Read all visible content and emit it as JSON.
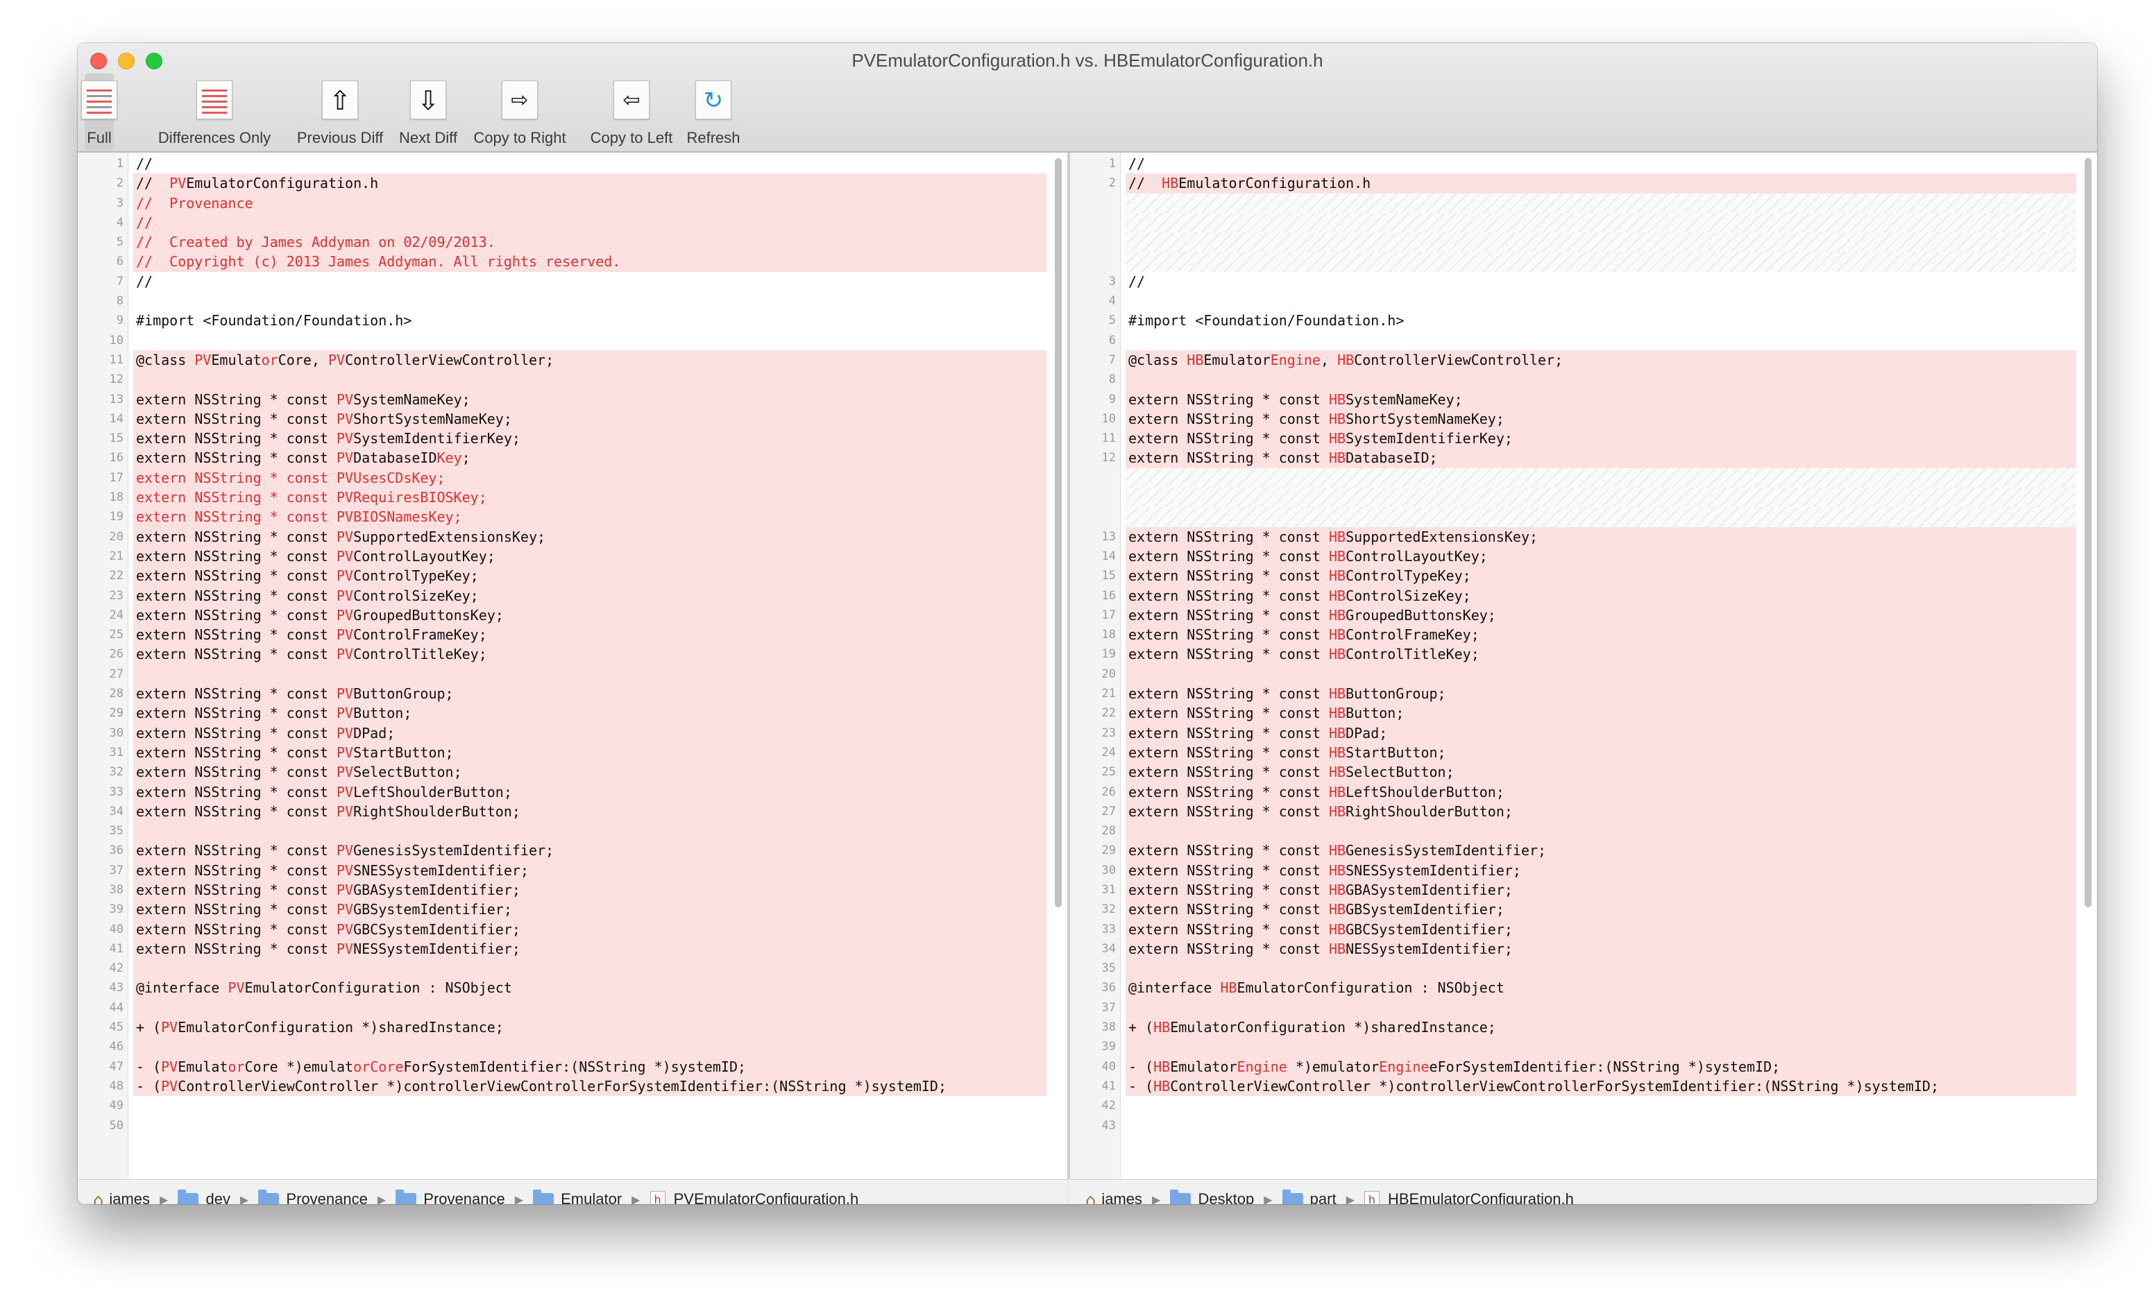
{
  "window": {
    "title": "PVEmulatorConfiguration.h vs. HBEmulatorConfiguration.h"
  },
  "toolbar": {
    "full": "Full",
    "differences_only": "Differences Only",
    "previous_diff": "Previous Diff",
    "next_diff": "Next Diff",
    "copy_to_right": "Copy to Right",
    "copy_to_left": "Copy to Left",
    "refresh": "Refresh"
  },
  "left": {
    "lines": [
      {
        "n": "1",
        "t": "//",
        "s": "n"
      },
      {
        "n": "2",
        "p": [
          "//  ",
          {
            "r": "PV"
          },
          "EmulatorConfiguration.h"
        ],
        "s": "d"
      },
      {
        "n": "3",
        "t": "//  Provenance",
        "s": "dr"
      },
      {
        "n": "4",
        "t": "//",
        "s": "dr"
      },
      {
        "n": "5",
        "t": "//  Created by James Addyman on 02/09/2013.",
        "s": "dr"
      },
      {
        "n": "6",
        "t": "//  Copyright (c) 2013 James Addyman. All rights reserved.",
        "s": "dr"
      },
      {
        "n": "7",
        "t": "//",
        "s": "n"
      },
      {
        "n": "8",
        "t": "",
        "s": "n"
      },
      {
        "n": "9",
        "t": "#import <Foundation/Foundation.h>",
        "s": "n"
      },
      {
        "n": "10",
        "t": "",
        "s": "n"
      },
      {
        "n": "11",
        "p": [
          "@class ",
          {
            "r": "PV"
          },
          "Emulat",
          {
            "r": "or"
          },
          "Core, ",
          {
            "r": "PV"
          },
          "ControllerViewController;"
        ],
        "s": "d"
      },
      {
        "n": "12",
        "t": "",
        "s": "d"
      },
      {
        "n": "13",
        "p": [
          "extern NSString * const ",
          {
            "r": "PV"
          },
          "SystemNameKey;"
        ],
        "s": "d"
      },
      {
        "n": "14",
        "p": [
          "extern NSString * const ",
          {
            "r": "PV"
          },
          "ShortSystemNameKey;"
        ],
        "s": "d"
      },
      {
        "n": "15",
        "p": [
          "extern NSString * const ",
          {
            "r": "PV"
          },
          "SystemIdentifierKey;"
        ],
        "s": "d"
      },
      {
        "n": "16",
        "p": [
          "extern NSString * const ",
          {
            "r": "PV"
          },
          "DatabaseID",
          {
            "r": "Key"
          },
          ";"
        ],
        "s": "d"
      },
      {
        "n": "17",
        "t": "extern NSString * const PVUsesCDsKey;",
        "s": "dr"
      },
      {
        "n": "18",
        "t": "extern NSString * const PVRequiresBIOSKey;",
        "s": "dr"
      },
      {
        "n": "19",
        "t": "extern NSString * const PVBIOSNamesKey;",
        "s": "dr"
      },
      {
        "n": "20",
        "p": [
          "extern NSString * const ",
          {
            "r": "PV"
          },
          "SupportedExtensionsKey;"
        ],
        "s": "d"
      },
      {
        "n": "21",
        "p": [
          "extern NSString * const ",
          {
            "r": "PV"
          },
          "ControlLayoutKey;"
        ],
        "s": "d"
      },
      {
        "n": "22",
        "p": [
          "extern NSString * const ",
          {
            "r": "PV"
          },
          "ControlTypeKey;"
        ],
        "s": "d"
      },
      {
        "n": "23",
        "p": [
          "extern NSString * const ",
          {
            "r": "PV"
          },
          "ControlSizeKey;"
        ],
        "s": "d"
      },
      {
        "n": "24",
        "p": [
          "extern NSString * const ",
          {
            "r": "PV"
          },
          "GroupedButtonsKey;"
        ],
        "s": "d"
      },
      {
        "n": "25",
        "p": [
          "extern NSString * const ",
          {
            "r": "PV"
          },
          "ControlFrameKey;"
        ],
        "s": "d"
      },
      {
        "n": "26",
        "p": [
          "extern NSString * const ",
          {
            "r": "PV"
          },
          "ControlTitleKey;"
        ],
        "s": "d"
      },
      {
        "n": "27",
        "t": "",
        "s": "d"
      },
      {
        "n": "28",
        "p": [
          "extern NSString * const ",
          {
            "r": "PV"
          },
          "ButtonGroup;"
        ],
        "s": "d"
      },
      {
        "n": "29",
        "p": [
          "extern NSString * const ",
          {
            "r": "PV"
          },
          "Button;"
        ],
        "s": "d"
      },
      {
        "n": "30",
        "p": [
          "extern NSString * const ",
          {
            "r": "PV"
          },
          "DPad;"
        ],
        "s": "d"
      },
      {
        "n": "31",
        "p": [
          "extern NSString * const ",
          {
            "r": "PV"
          },
          "StartButton;"
        ],
        "s": "d"
      },
      {
        "n": "32",
        "p": [
          "extern NSString * const ",
          {
            "r": "PV"
          },
          "SelectButton;"
        ],
        "s": "d"
      },
      {
        "n": "33",
        "p": [
          "extern NSString * const ",
          {
            "r": "PV"
          },
          "LeftShoulderButton;"
        ],
        "s": "d"
      },
      {
        "n": "34",
        "p": [
          "extern NSString * const ",
          {
            "r": "PV"
          },
          "RightShoulderButton;"
        ],
        "s": "d"
      },
      {
        "n": "35",
        "t": "",
        "s": "d"
      },
      {
        "n": "36",
        "p": [
          "extern NSString * const ",
          {
            "r": "PV"
          },
          "GenesisSystemIdentifier;"
        ],
        "s": "d"
      },
      {
        "n": "37",
        "p": [
          "extern NSString * const ",
          {
            "r": "PV"
          },
          "SNESSystemIdentifier;"
        ],
        "s": "d"
      },
      {
        "n": "38",
        "p": [
          "extern NSString * const ",
          {
            "r": "PV"
          },
          "GBASystemIdentifier;"
        ],
        "s": "d"
      },
      {
        "n": "39",
        "p": [
          "extern NSString * const ",
          {
            "r": "PV"
          },
          "GBSystemIdentifier;"
        ],
        "s": "d"
      },
      {
        "n": "40",
        "p": [
          "extern NSString * const ",
          {
            "r": "PV"
          },
          "GBCSystemIdentifier;"
        ],
        "s": "d"
      },
      {
        "n": "41",
        "p": [
          "extern NSString * const ",
          {
            "r": "PV"
          },
          "NESSystemIdentifier;"
        ],
        "s": "d"
      },
      {
        "n": "42",
        "t": "",
        "s": "d"
      },
      {
        "n": "43",
        "p": [
          "@interface ",
          {
            "r": "PV"
          },
          "EmulatorConfiguration : NSObject"
        ],
        "s": "d"
      },
      {
        "n": "44",
        "t": "",
        "s": "d"
      },
      {
        "n": "45",
        "p": [
          "+ (",
          {
            "r": "PV"
          },
          "EmulatorConfiguration *)sharedInstance;"
        ],
        "s": "d"
      },
      {
        "n": "46",
        "t": "",
        "s": "d"
      },
      {
        "n": "47",
        "p": [
          "- (",
          {
            "r": "PV"
          },
          "Emulat",
          {
            "r": "or"
          },
          "Core *)emulat",
          {
            "r": "orCore"
          },
          "ForSystemIdentifier:(NSString *)systemID;"
        ],
        "s": "d"
      },
      {
        "n": "48",
        "p": [
          "- (",
          {
            "r": "PV"
          },
          "ControllerViewController *)controllerViewControllerForSystemIdentifier:(NSString *)systemID;"
        ],
        "s": "d"
      },
      {
        "n": "49",
        "t": "",
        "s": "n"
      },
      {
        "n": "50",
        "t": "",
        "s": "n"
      }
    ]
  },
  "right": {
    "lines": [
      {
        "n": "1",
        "t": "//",
        "s": "n"
      },
      {
        "n": "2",
        "p": [
          "//  ",
          {
            "r": "HB"
          },
          "EmulatorConfiguration.h"
        ],
        "s": "d"
      },
      {
        "n": "",
        "t": "",
        "s": "gap"
      },
      {
        "n": "",
        "t": "",
        "s": "gap"
      },
      {
        "n": "",
        "t": "",
        "s": "gap"
      },
      {
        "n": "",
        "t": "",
        "s": "gap"
      },
      {
        "n": "3",
        "t": "//",
        "s": "n"
      },
      {
        "n": "4",
        "t": "",
        "s": "n"
      },
      {
        "n": "5",
        "t": "#import <Foundation/Foundation.h>",
        "s": "n"
      },
      {
        "n": "6",
        "t": "",
        "s": "n"
      },
      {
        "n": "7",
        "p": [
          "@class ",
          {
            "r": "HB"
          },
          "Emulator",
          {
            "r": "Engine"
          },
          ", ",
          {
            "r": "HB"
          },
          "ControllerViewController;"
        ],
        "s": "d"
      },
      {
        "n": "8",
        "t": "",
        "s": "d"
      },
      {
        "n": "9",
        "p": [
          "extern NSString * const ",
          {
            "r": "HB"
          },
          "SystemNameKey;"
        ],
        "s": "d"
      },
      {
        "n": "10",
        "p": [
          "extern NSString * const ",
          {
            "r": "HB"
          },
          "ShortSystemNameKey;"
        ],
        "s": "d"
      },
      {
        "n": "11",
        "p": [
          "extern NSString * const ",
          {
            "r": "HB"
          },
          "SystemIdentifierKey;"
        ],
        "s": "d"
      },
      {
        "n": "12",
        "p": [
          "extern NSString * const ",
          {
            "r": "HB"
          },
          "DatabaseID;"
        ],
        "s": "d"
      },
      {
        "n": "",
        "t": "",
        "s": "gap"
      },
      {
        "n": "",
        "t": "",
        "s": "gap"
      },
      {
        "n": "",
        "t": "",
        "s": "gap"
      },
      {
        "n": "13",
        "p": [
          "extern NSString * const ",
          {
            "r": "HB"
          },
          "SupportedExtensionsKey;"
        ],
        "s": "d"
      },
      {
        "n": "14",
        "p": [
          "extern NSString * const ",
          {
            "r": "HB"
          },
          "ControlLayoutKey;"
        ],
        "s": "d"
      },
      {
        "n": "15",
        "p": [
          "extern NSString * const ",
          {
            "r": "HB"
          },
          "ControlTypeKey;"
        ],
        "s": "d"
      },
      {
        "n": "16",
        "p": [
          "extern NSString * const ",
          {
            "r": "HB"
          },
          "ControlSizeKey;"
        ],
        "s": "d"
      },
      {
        "n": "17",
        "p": [
          "extern NSString * const ",
          {
            "r": "HB"
          },
          "GroupedButtonsKey;"
        ],
        "s": "d"
      },
      {
        "n": "18",
        "p": [
          "extern NSString * const ",
          {
            "r": "HB"
          },
          "ControlFrameKey;"
        ],
        "s": "d"
      },
      {
        "n": "19",
        "p": [
          "extern NSString * const ",
          {
            "r": "HB"
          },
          "ControlTitleKey;"
        ],
        "s": "d"
      },
      {
        "n": "20",
        "t": "",
        "s": "d"
      },
      {
        "n": "21",
        "p": [
          "extern NSString * const ",
          {
            "r": "HB"
          },
          "ButtonGroup;"
        ],
        "s": "d"
      },
      {
        "n": "22",
        "p": [
          "extern NSString * const ",
          {
            "r": "HB"
          },
          "Button;"
        ],
        "s": "d"
      },
      {
        "n": "23",
        "p": [
          "extern NSString * const ",
          {
            "r": "HB"
          },
          "DPad;"
        ],
        "s": "d"
      },
      {
        "n": "24",
        "p": [
          "extern NSString * const ",
          {
            "r": "HB"
          },
          "StartButton;"
        ],
        "s": "d"
      },
      {
        "n": "25",
        "p": [
          "extern NSString * const ",
          {
            "r": "HB"
          },
          "SelectButton;"
        ],
        "s": "d"
      },
      {
        "n": "26",
        "p": [
          "extern NSString * const ",
          {
            "r": "HB"
          },
          "LeftShoulderButton;"
        ],
        "s": "d"
      },
      {
        "n": "27",
        "p": [
          "extern NSString * const ",
          {
            "r": "HB"
          },
          "RightShoulderButton;"
        ],
        "s": "d"
      },
      {
        "n": "28",
        "t": "",
        "s": "d"
      },
      {
        "n": "29",
        "p": [
          "extern NSString * const ",
          {
            "r": "HB"
          },
          "GenesisSystemIdentifier;"
        ],
        "s": "d"
      },
      {
        "n": "30",
        "p": [
          "extern NSString * const ",
          {
            "r": "HB"
          },
          "SNESSystemIdentifier;"
        ],
        "s": "d"
      },
      {
        "n": "31",
        "p": [
          "extern NSString * const ",
          {
            "r": "HB"
          },
          "GBASystemIdentifier;"
        ],
        "s": "d"
      },
      {
        "n": "32",
        "p": [
          "extern NSString * const ",
          {
            "r": "HB"
          },
          "GBSystemIdentifier;"
        ],
        "s": "d"
      },
      {
        "n": "33",
        "p": [
          "extern NSString * const ",
          {
            "r": "HB"
          },
          "GBCSystemIdentifier;"
        ],
        "s": "d"
      },
      {
        "n": "34",
        "p": [
          "extern NSString * const ",
          {
            "r": "HB"
          },
          "NESSystemIdentifier;"
        ],
        "s": "d"
      },
      {
        "n": "35",
        "t": "",
        "s": "d"
      },
      {
        "n": "36",
        "p": [
          "@interface ",
          {
            "r": "HB"
          },
          "EmulatorConfiguration : NSObject"
        ],
        "s": "d"
      },
      {
        "n": "37",
        "t": "",
        "s": "d"
      },
      {
        "n": "38",
        "p": [
          "+ (",
          {
            "r": "HB"
          },
          "EmulatorConfiguration *)sharedInstance;"
        ],
        "s": "d"
      },
      {
        "n": "39",
        "t": "",
        "s": "d"
      },
      {
        "n": "40",
        "p": [
          "- (",
          {
            "r": "HB"
          },
          "Emulator",
          {
            "r": "Engine"
          },
          " *)emulator",
          {
            "r": "Engine"
          },
          "eForSystemIdentifier:(NSString *)systemID;"
        ],
        "s": "d"
      },
      {
        "n": "41",
        "p": [
          "- (",
          {
            "r": "HB"
          },
          "ControllerViewController *)controllerViewControllerForSystemIdentifier:(NSString *)systemID;"
        ],
        "s": "d"
      },
      {
        "n": "42",
        "t": "",
        "s": "n"
      },
      {
        "n": "43",
        "t": "",
        "s": "n"
      }
    ]
  },
  "path_left": {
    "items": [
      "james",
      "dev",
      "Provenance",
      "Provenance",
      "Emulator",
      "PVEmulatorConfiguration.h"
    ]
  },
  "path_right": {
    "items": [
      "james",
      "Desktop",
      "part",
      "HBEmulatorConfiguration.h"
    ]
  },
  "colors": {
    "diff_bg": "#fde0e0",
    "diff_text": "#e03030"
  }
}
